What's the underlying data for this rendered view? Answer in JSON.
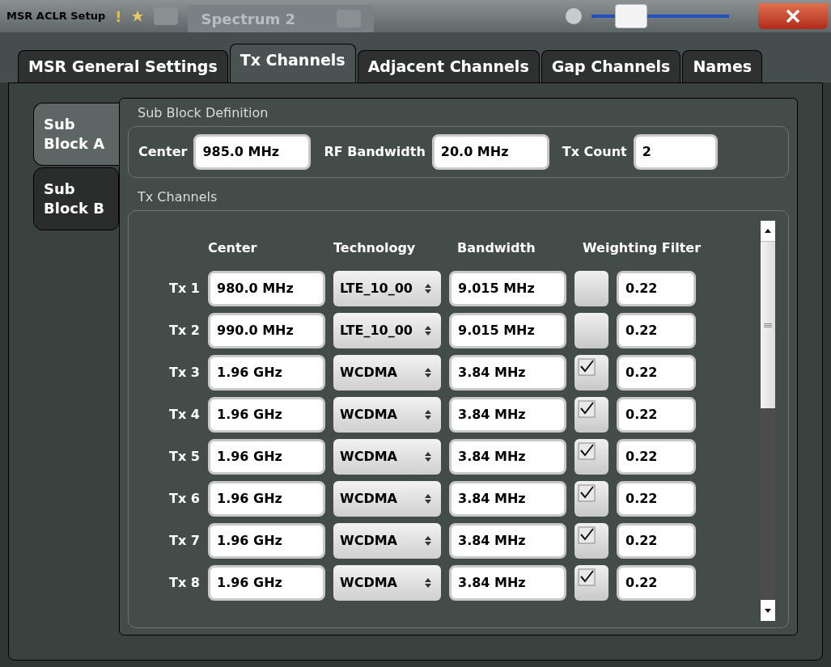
{
  "window": {
    "title": "MSR ACLR Setup",
    "warning": "!",
    "background_tabs": [
      {
        "label": "Spectrum 2"
      }
    ],
    "slider": {
      "level": 0.22
    }
  },
  "tabs": [
    {
      "label": "MSR General Settings",
      "selected": false
    },
    {
      "label": "Tx Channels",
      "selected": true
    },
    {
      "label": "Adjacent Channels",
      "selected": false
    },
    {
      "label": "Gap Channels",
      "selected": false
    },
    {
      "label": "Names",
      "selected": false
    }
  ],
  "sub_blocks": [
    {
      "label": "Sub Block A",
      "selected": true
    },
    {
      "label": "Sub Block B",
      "selected": false
    }
  ],
  "sub_block_definition": {
    "title": "Sub Block Definition",
    "fields": [
      {
        "label": "Center",
        "value": "985.0 MHz"
      },
      {
        "label": "RF Bandwidth",
        "value": "20.0 MHz"
      },
      {
        "label": "Tx Count",
        "value": "2"
      }
    ]
  },
  "tx_channels": {
    "title": "Tx Channels",
    "columns": [
      "Center",
      "Technology",
      "Bandwidth",
      "Weighting Filter"
    ],
    "rows": [
      {
        "label": "Tx 1",
        "center": "980.0 MHz",
        "technology": "LTE_10_00",
        "bandwidth": "9.015 MHz",
        "weighting": false,
        "filter": "0.22"
      },
      {
        "label": "Tx 2",
        "center": "990.0 MHz",
        "technology": "LTE_10_00",
        "bandwidth": "9.015 MHz",
        "weighting": false,
        "filter": "0.22"
      },
      {
        "label": "Tx 3",
        "center": "1.96 GHz",
        "technology": "WCDMA",
        "bandwidth": "3.84 MHz",
        "weighting": true,
        "filter": "0.22"
      },
      {
        "label": "Tx 4",
        "center": "1.96 GHz",
        "technology": "WCDMA",
        "bandwidth": "3.84 MHz",
        "weighting": true,
        "filter": "0.22"
      },
      {
        "label": "Tx 5",
        "center": "1.96 GHz",
        "technology": "WCDMA",
        "bandwidth": "3.84 MHz",
        "weighting": true,
        "filter": "0.22"
      },
      {
        "label": "Tx 6",
        "center": "1.96 GHz",
        "technology": "WCDMA",
        "bandwidth": "3.84 MHz",
        "weighting": true,
        "filter": "0.22"
      },
      {
        "label": "Tx 7",
        "center": "1.96 GHz",
        "technology": "WCDMA",
        "bandwidth": "3.84 MHz",
        "weighting": true,
        "filter": "0.22"
      },
      {
        "label": "Tx 8",
        "center": "1.96 GHz",
        "technology": "WCDMA",
        "bandwidth": "3.84 MHz",
        "weighting": true,
        "filter": "0.22"
      }
    ]
  }
}
